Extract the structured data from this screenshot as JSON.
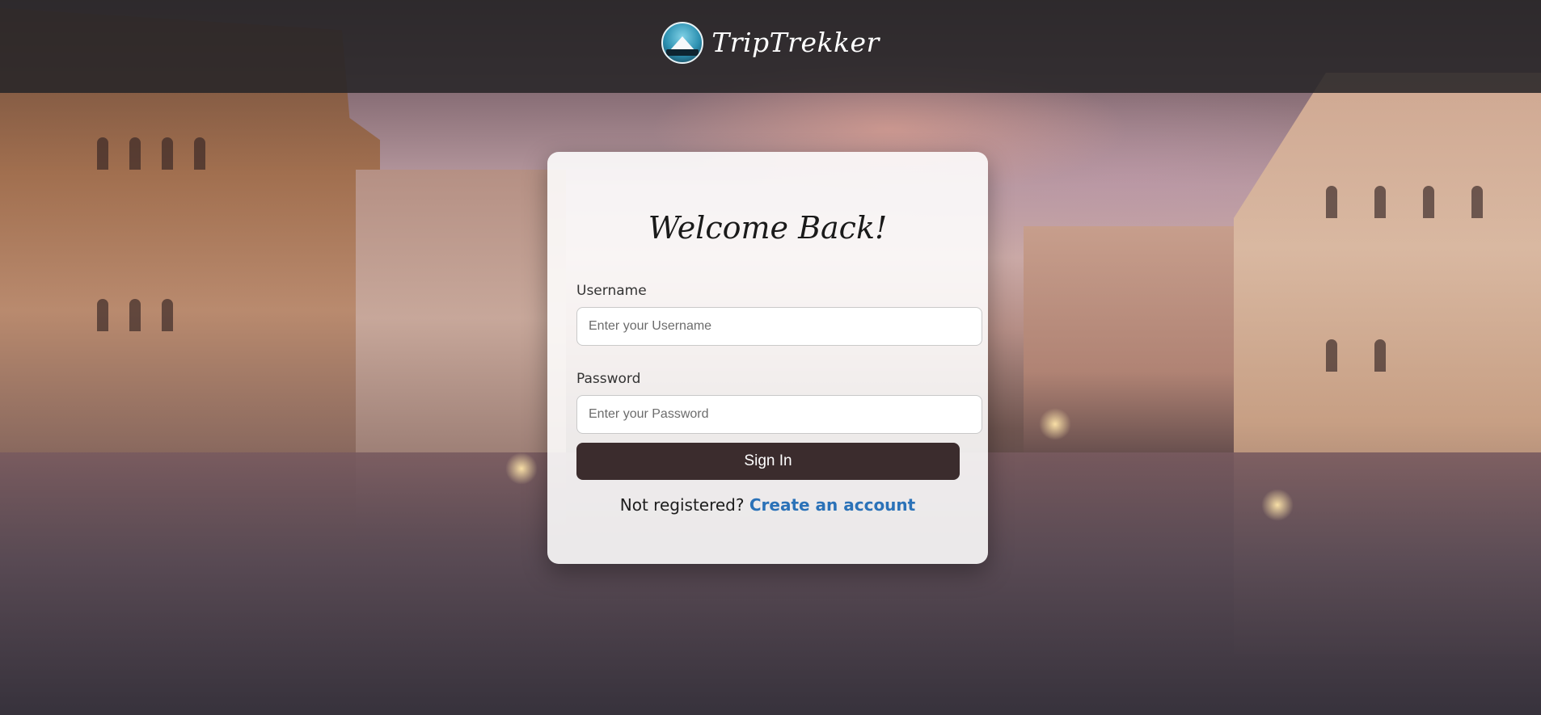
{
  "header": {
    "brand_name": "TripTrekker",
    "logo_icon": "triptrekker-logo-icon"
  },
  "login": {
    "title": "Welcome Back!",
    "username_label": "Username",
    "username_placeholder": "Enter your Username",
    "username_value": "",
    "password_label": "Password",
    "password_placeholder": "Enter your Password",
    "password_value": "",
    "submit_label": "Sign In",
    "register_prompt": "Not registered?",
    "register_link": "Create an account"
  },
  "colors": {
    "header_bg": "#282628",
    "card_bg": "#ffffff",
    "button_bg": "#3b2c2d",
    "link": "#2b72b8"
  }
}
